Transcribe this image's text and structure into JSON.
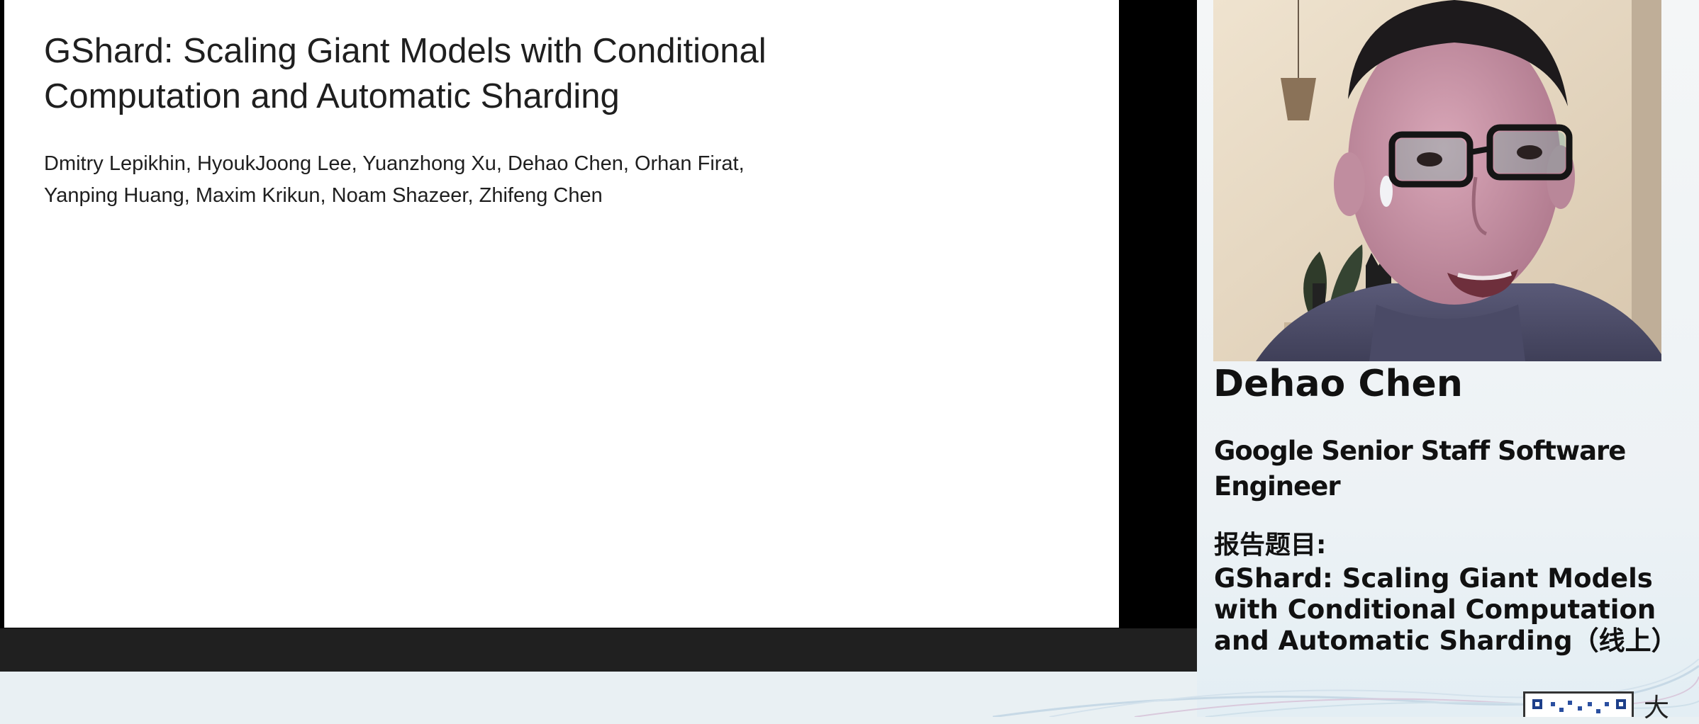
{
  "slide": {
    "title_lines": [
      "GShard: Scaling Giant Models with Conditional",
      "Computation and Automatic Sharding"
    ],
    "author_lines": [
      "Dmitry Lepikhin, HyoukJoong Lee, Yuanzhong Xu, Dehao Chen, Orhan Firat,",
      "Yanping Huang, Maxim Krikun, Noam Shazeer, Zhifeng Chen"
    ]
  },
  "speaker": {
    "name": "Dehao Chen",
    "role_lines": [
      "Google Senior Staff Software",
      "Engineer"
    ],
    "topic_label": "报告题目:",
    "topic_lines": [
      "GShard: Scaling Giant Models",
      "with Conditional Computation",
      "and Automatic Sharding（线上）"
    ]
  },
  "corner": {
    "char": "大"
  },
  "colors": {
    "frame": "#000000",
    "bottom_bar": "#202020",
    "slide_bg": "#ffffff",
    "panel_bg": "#f4f6f7",
    "wave_accent": "#c7d9e6"
  }
}
